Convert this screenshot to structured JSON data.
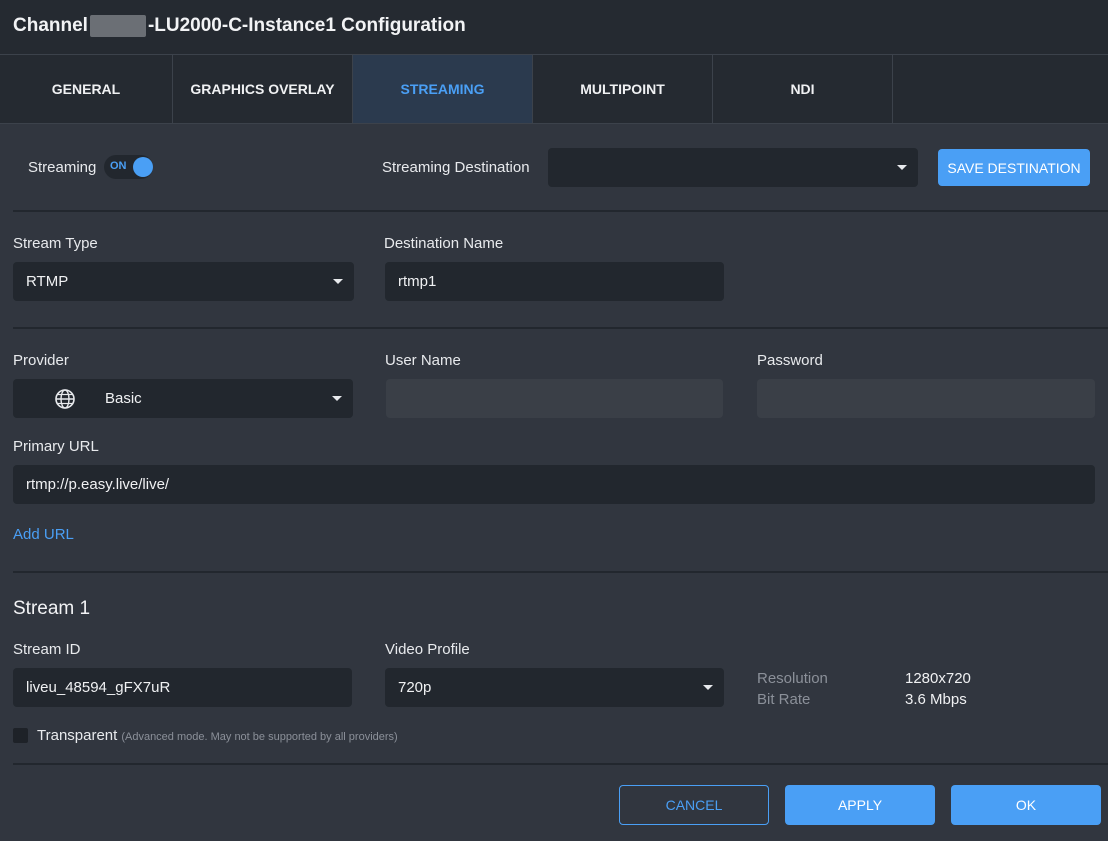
{
  "window": {
    "title_prefix": "Channel",
    "title_suffix": "-LU2000-C-Instance1 Configuration"
  },
  "tabs": [
    {
      "label": "GENERAL"
    },
    {
      "label": "GRAPHICS OVERLAY"
    },
    {
      "label": "STREAMING",
      "active": true
    },
    {
      "label": "MULTIPOINT"
    },
    {
      "label": "NDI"
    }
  ],
  "streaming": {
    "label": "Streaming",
    "toggle_state": "ON",
    "destination_label": "Streaming Destination",
    "destination_value": "",
    "save_destination": "SAVE DESTINATION"
  },
  "stream_type": {
    "label": "Stream Type",
    "value": "RTMP"
  },
  "destination_name": {
    "label": "Destination Name",
    "value": "rtmp1"
  },
  "provider": {
    "label": "Provider",
    "value": "Basic",
    "icon": "globe-icon"
  },
  "user_name": {
    "label": "User Name",
    "value": ""
  },
  "password": {
    "label": "Password",
    "value": ""
  },
  "primary_url": {
    "label": "Primary URL",
    "value": "rtmp://p.easy.live/live/"
  },
  "add_url": "Add URL",
  "stream1": {
    "title": "Stream 1",
    "stream_id_label": "Stream ID",
    "stream_id_value": "liveu_48594_gFX7uR",
    "video_profile_label": "Video Profile",
    "video_profile_value": "720p",
    "resolution_label": "Resolution",
    "resolution_value": "1280x720",
    "bitrate_label": "Bit Rate",
    "bitrate_value": "3.6 Mbps",
    "transparent_label": "Transparent",
    "transparent_hint": "(Advanced mode. May not be supported by all providers)"
  },
  "footer": {
    "cancel": "CANCEL",
    "apply": "APPLY",
    "ok": "OK"
  },
  "colors": {
    "accent": "#4a9ff5",
    "background": "#31363f",
    "field": "#22272e",
    "header": "#252a31"
  }
}
